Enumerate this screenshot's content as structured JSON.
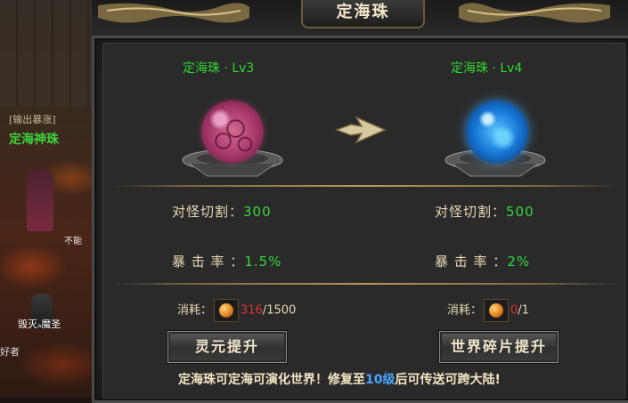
{
  "window": {
    "title": "定海珠"
  },
  "game_bg": {
    "output_label": "[输出暴涨]",
    "pearl_name": "定海神珠",
    "cannot_label": "不能",
    "player1": "毁灭ₐ魔圣",
    "player2": "好者"
  },
  "current": {
    "name": "定海珠 · Lv3",
    "orb_color": "#a53768",
    "stats": [
      {
        "label": "对怪切割：",
        "value": "300"
      },
      {
        "label": "暴 击 率 ：",
        "value": "1.5%"
      }
    ],
    "cost_label": "消耗：",
    "cost_current": "316",
    "cost_total": "/1500",
    "button_label": "灵元提升"
  },
  "next": {
    "name": "定海珠 · Lv4",
    "orb_color": "#1677d6",
    "stats": [
      {
        "label": "对怪切割：",
        "value": "500"
      },
      {
        "label": "暴 击 率 ：",
        "value": "2%"
      }
    ],
    "cost_label": "消耗：",
    "cost_current": "0",
    "cost_total": "/1",
    "button_label": "世界碎片提升"
  },
  "footer": {
    "before": "定海珠可定海可演化世界！修复至",
    "highlight": "10级",
    "after": "后可传送可跨大陆!"
  },
  "colors": {
    "value_green": "#35d83b",
    "label_gold": "#e6d8b5",
    "cost_red": "#e03030"
  }
}
